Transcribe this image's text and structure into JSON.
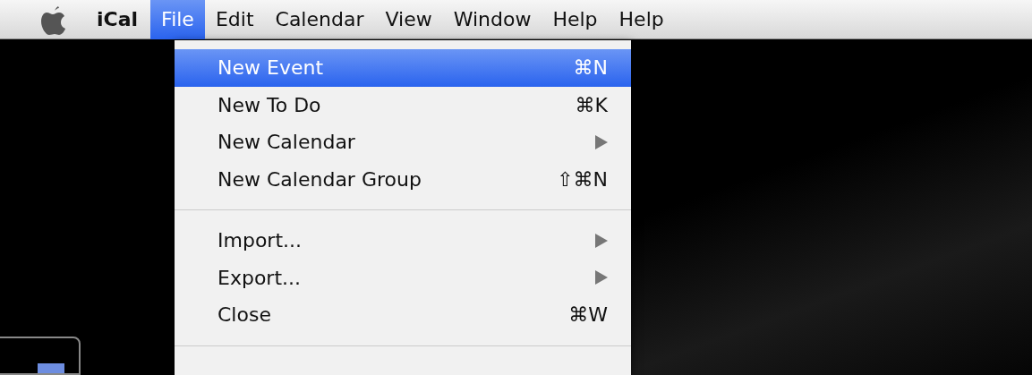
{
  "menubar": {
    "app_name": "iCal",
    "menus": [
      {
        "label": "File",
        "selected": true
      },
      {
        "label": "Edit",
        "selected": false
      },
      {
        "label": "Calendar",
        "selected": false
      },
      {
        "label": "View",
        "selected": false
      },
      {
        "label": "Window",
        "selected": false
      },
      {
        "label": "Help",
        "selected": false
      },
      {
        "label": "Help",
        "selected": false
      }
    ]
  },
  "file_menu": {
    "items": [
      {
        "kind": "item",
        "label": "New Event",
        "shortcut": "⌘N",
        "selected": true
      },
      {
        "kind": "item",
        "label": "New To Do",
        "shortcut": "⌘K",
        "selected": false
      },
      {
        "kind": "item",
        "label": "New Calendar",
        "submenu": true,
        "selected": false
      },
      {
        "kind": "item",
        "label": "New Calendar Group",
        "shortcut": "⇧⌘N",
        "selected": false
      },
      {
        "kind": "separator"
      },
      {
        "kind": "item",
        "label": "Import...",
        "submenu": true,
        "selected": false
      },
      {
        "kind": "item",
        "label": "Export...",
        "submenu": true,
        "selected": false
      },
      {
        "kind": "item",
        "label": "Close",
        "shortcut": "⌘W",
        "selected": false
      },
      {
        "kind": "separator"
      }
    ]
  }
}
